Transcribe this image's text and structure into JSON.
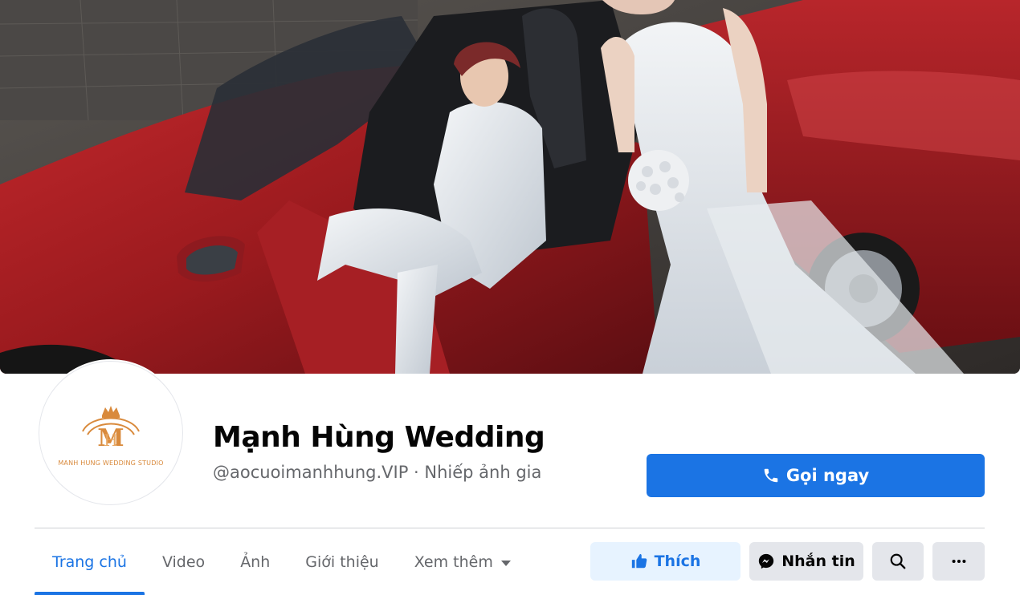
{
  "page": {
    "name": "Mạnh Hùng Wedding",
    "handle": "@aocuoimanhhung.VIP",
    "separator": " · ",
    "category": "Nhiếp ảnh gia",
    "logo_caption": "MANH HUNG WEDDING STUDIO"
  },
  "actions": {
    "call_label": "Gọi ngay",
    "like_label": "Thích",
    "message_label": "Nhắn tin"
  },
  "tabs": [
    {
      "label": "Trang chủ",
      "active": true
    },
    {
      "label": "Video"
    },
    {
      "label": "Ảnh"
    },
    {
      "label": "Giới thiệu"
    },
    {
      "label": "Xem thêm"
    }
  ],
  "colors": {
    "primary": "#1b74e4",
    "secondary_button": "#e4e6eb",
    "like_bg": "#e7f3ff",
    "logo_gold": "#d98a3c"
  },
  "icons": {
    "call": "phone-icon",
    "like": "thumbs-up-icon",
    "message": "messenger-icon",
    "search": "search-icon",
    "more": "more-dots-icon",
    "see_more": "caret-down-icon"
  }
}
